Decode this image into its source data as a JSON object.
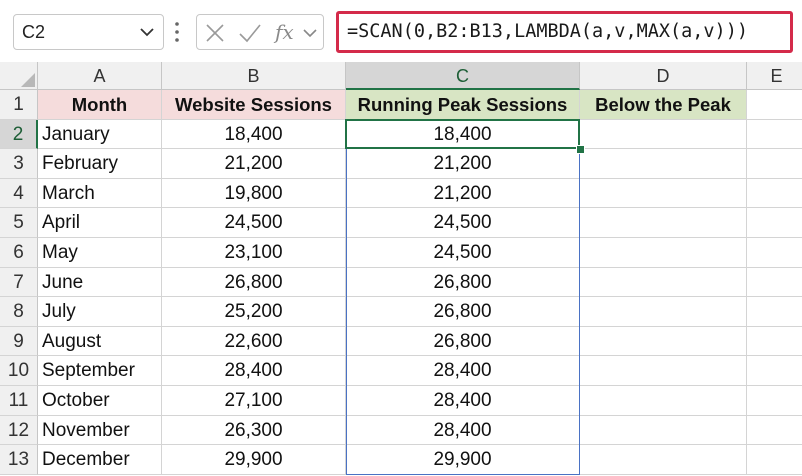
{
  "name_box": {
    "value": "C2"
  },
  "formula_bar": {
    "formula": "=SCAN(0,B2:B13,LAMBDA(a,v,MAX(a,v)))",
    "fx_label": "fx",
    "highlight_color": "#d42a4a"
  },
  "column_headers": [
    "A",
    "B",
    "C",
    "D",
    "E"
  ],
  "row_numbers": [
    "1",
    "2",
    "3",
    "4",
    "5",
    "6",
    "7",
    "8",
    "9",
    "10",
    "11",
    "12",
    "13"
  ],
  "selected_column": "C",
  "selected_row": "2",
  "table": {
    "headers": {
      "month": "Month",
      "sessions": "Website Sessions",
      "running_peak": "Running Peak Sessions",
      "below_peak": "Below the Peak"
    },
    "rows": [
      {
        "month": "January",
        "sessions": "18,400",
        "running_peak": "18,400"
      },
      {
        "month": "February",
        "sessions": "21,200",
        "running_peak": "21,200"
      },
      {
        "month": "March",
        "sessions": "19,800",
        "running_peak": "21,200"
      },
      {
        "month": "April",
        "sessions": "24,500",
        "running_peak": "24,500"
      },
      {
        "month": "May",
        "sessions": "23,100",
        "running_peak": "24,500"
      },
      {
        "month": "June",
        "sessions": "26,800",
        "running_peak": "26,800"
      },
      {
        "month": "July",
        "sessions": "25,200",
        "running_peak": "26,800"
      },
      {
        "month": "August",
        "sessions": "22,600",
        "running_peak": "26,800"
      },
      {
        "month": "September",
        "sessions": "28,400",
        "running_peak": "28,400"
      },
      {
        "month": "October",
        "sessions": "27,100",
        "running_peak": "28,400"
      },
      {
        "month": "November",
        "sessions": "26,300",
        "running_peak": "28,400"
      },
      {
        "month": "December",
        "sessions": "29,900",
        "running_peak": "29,900"
      }
    ]
  },
  "colors": {
    "header_pink": "#f5dcdc",
    "header_green": "#d8e5c4",
    "selection_green": "#217346",
    "spill_border": "#4a72c4"
  },
  "icons": [
    "chevron-down-icon",
    "more-options-icon",
    "cancel-icon",
    "enter-check-icon",
    "insert-function-icon"
  ]
}
